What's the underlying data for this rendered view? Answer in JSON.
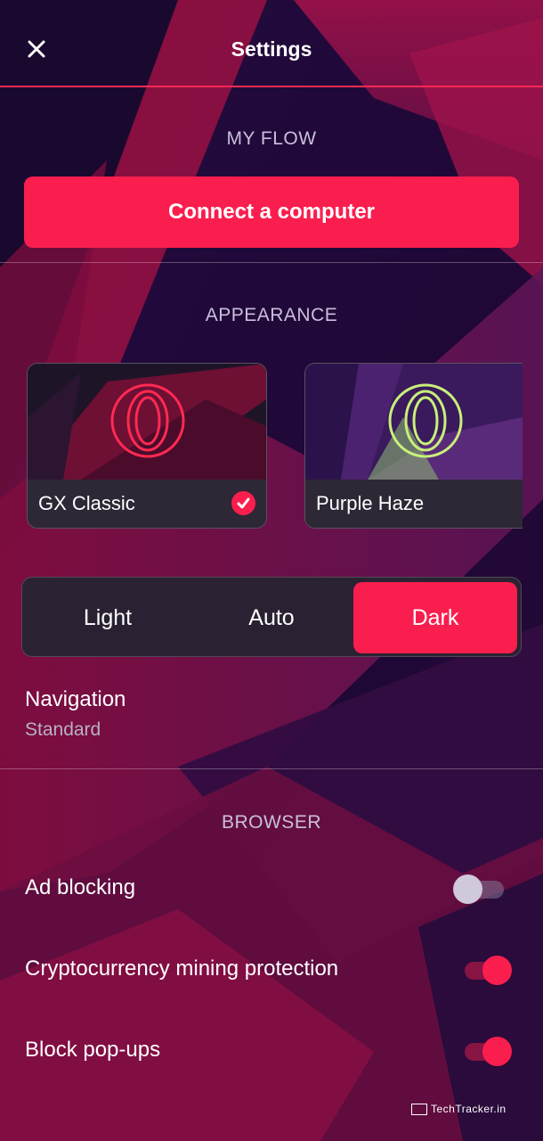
{
  "header": {
    "title": "Settings",
    "close_icon": "close-icon"
  },
  "my_flow": {
    "section_title": "MY FLOW",
    "connect_button": "Connect a computer"
  },
  "appearance": {
    "section_title": "APPEARANCE",
    "themes": [
      {
        "label": "GX Classic",
        "selected": true,
        "accent": "#ff2a52"
      },
      {
        "label": "Purple Haze",
        "selected": false,
        "accent": "#c7f07a"
      }
    ],
    "modes": [
      {
        "label": "Light",
        "active": false
      },
      {
        "label": "Auto",
        "active": false
      },
      {
        "label": "Dark",
        "active": true
      }
    ],
    "navigation": {
      "label": "Navigation",
      "value": "Standard"
    }
  },
  "browser": {
    "section_title": "BROWSER",
    "settings": [
      {
        "label": "Ad blocking",
        "enabled": false
      },
      {
        "label": "Cryptocurrency mining protection",
        "enabled": true
      },
      {
        "label": "Block pop-ups",
        "enabled": true
      }
    ]
  },
  "watermark": "TechTracker.in",
  "colors": {
    "accent": "#fa1e4e",
    "background": "#1b0b3c"
  }
}
